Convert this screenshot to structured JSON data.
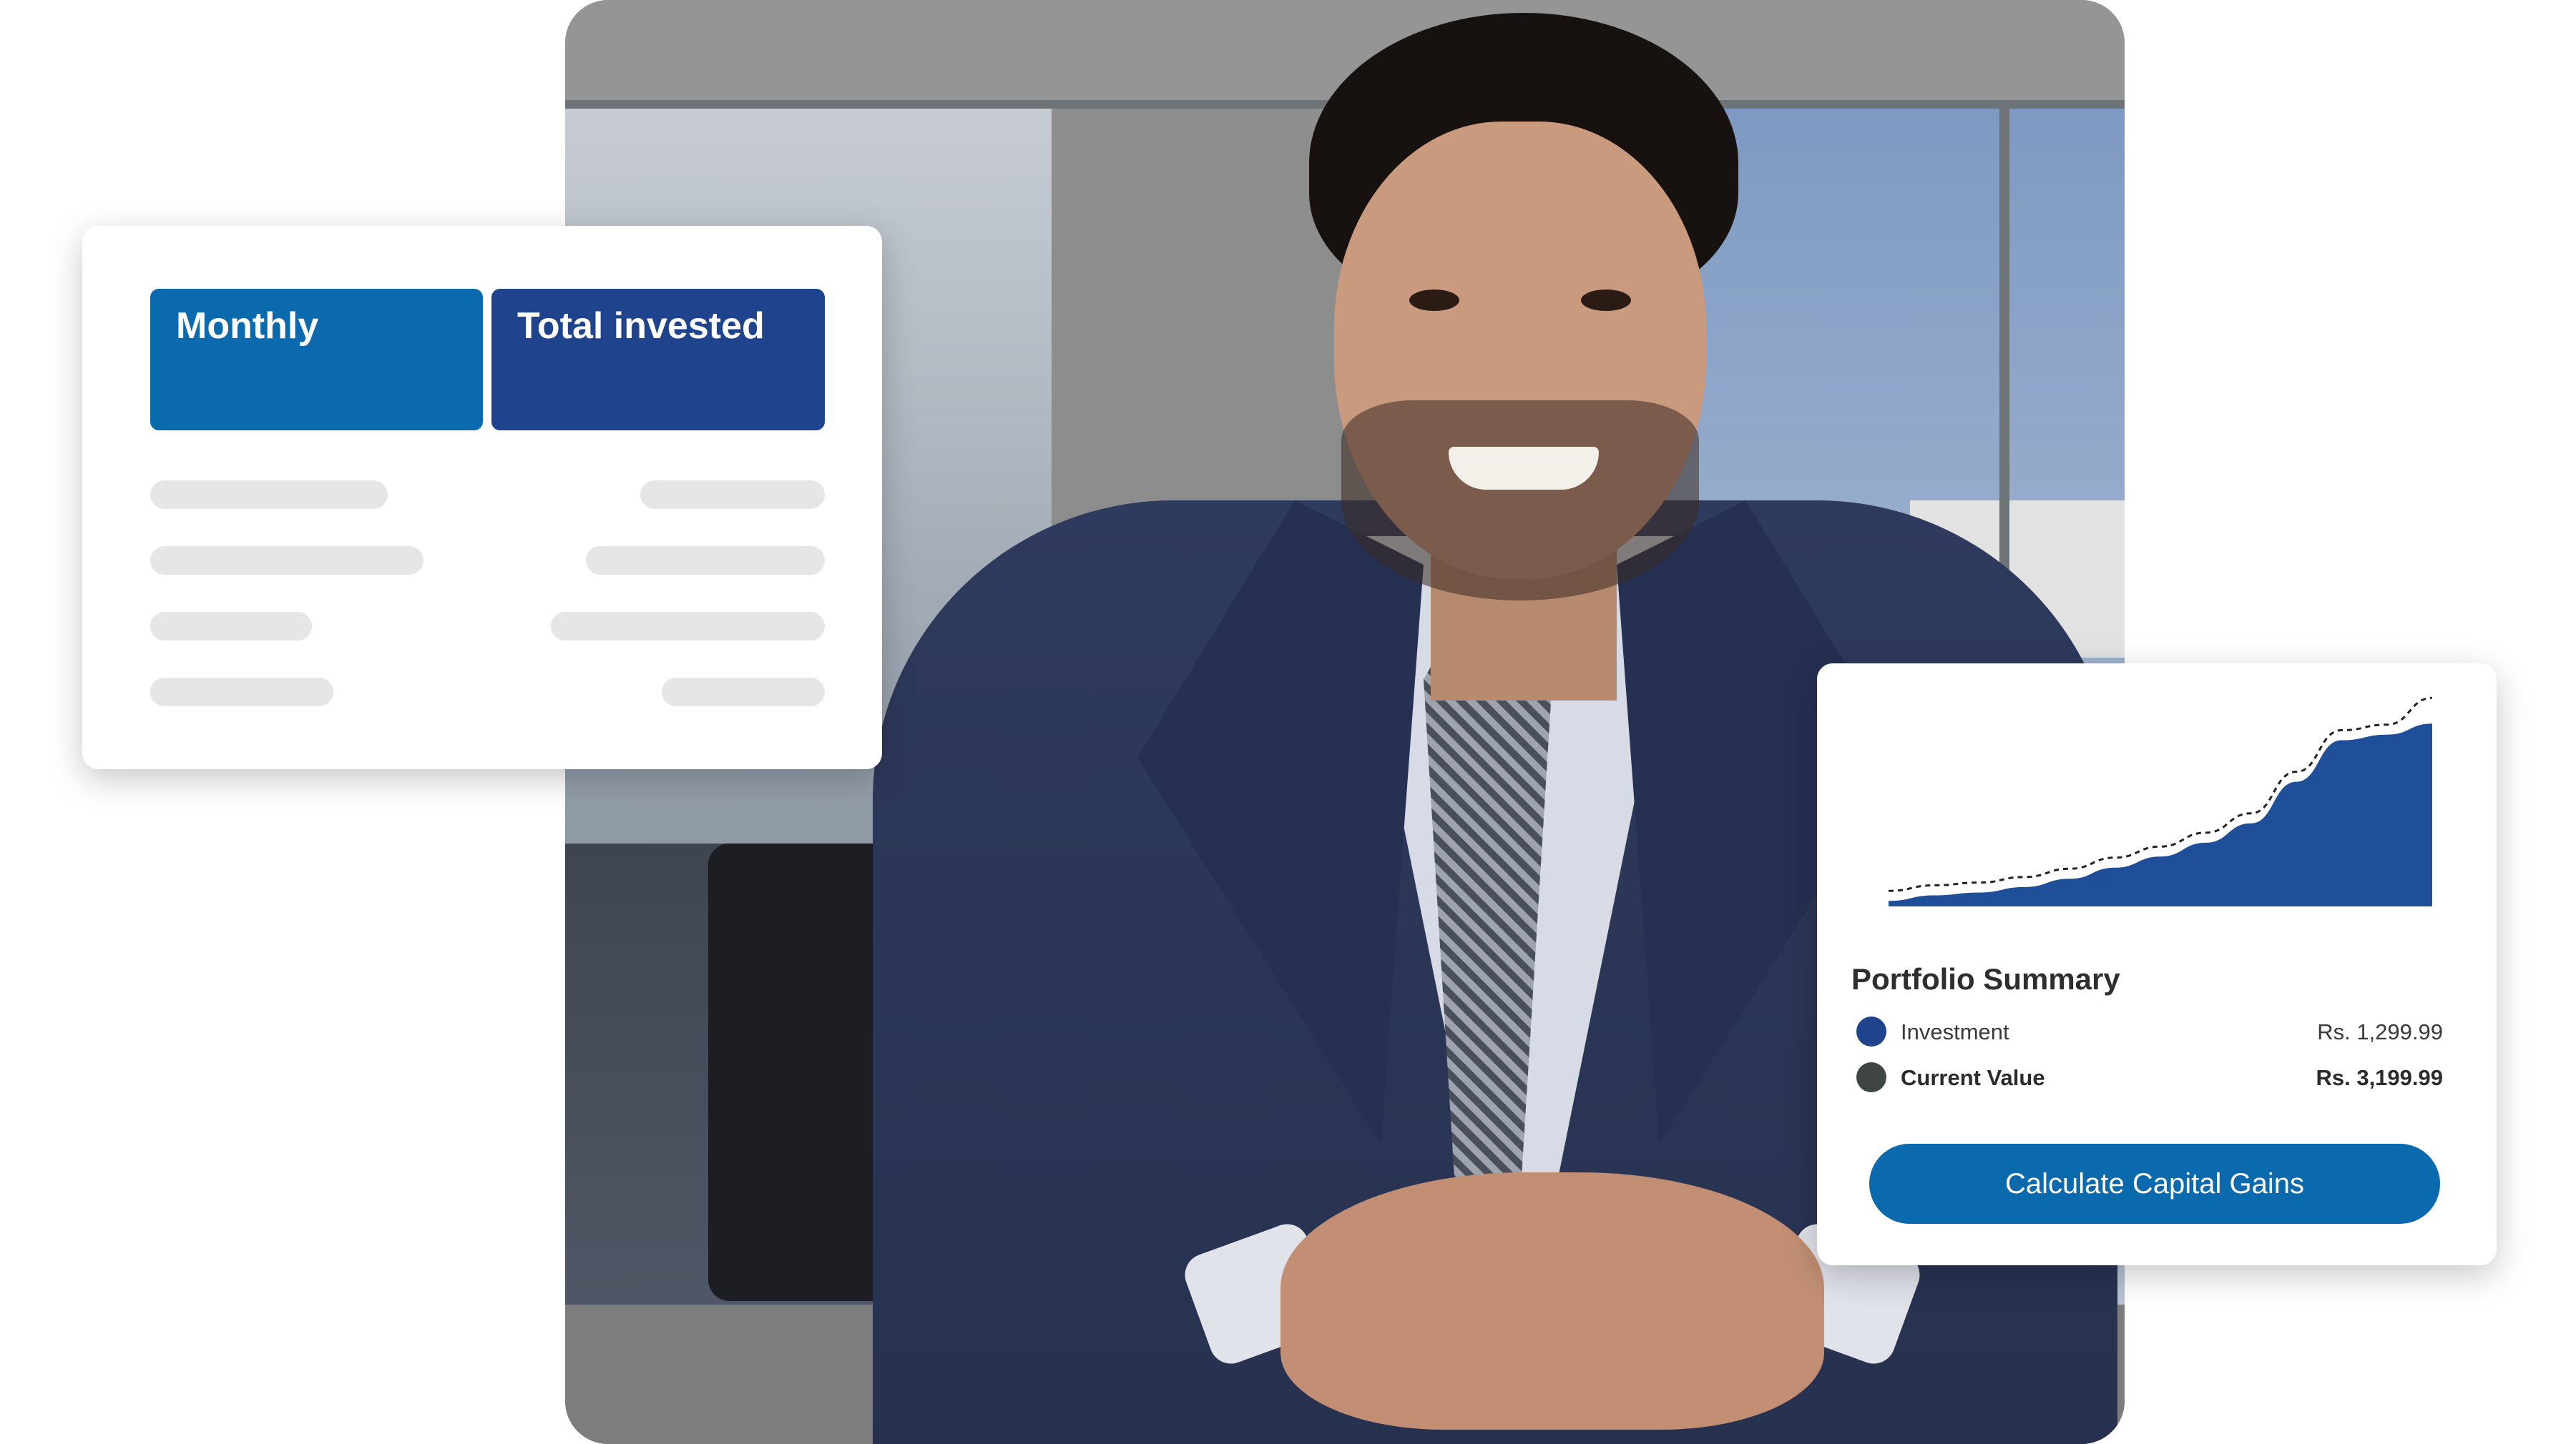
{
  "left_card": {
    "tabs": [
      {
        "label": "Monthly",
        "color": "#0b6aad"
      },
      {
        "label": "Total invested",
        "color": "#1f438d"
      }
    ]
  },
  "portfolio_card": {
    "title": "Portfolio Summary",
    "rows": [
      {
        "label": "Investment",
        "value": "Rs. 1,299.99",
        "dot_color": "#1f438d"
      },
      {
        "label": "Current Value",
        "value": "Rs. 3,199.99",
        "dot_color": "#3f4444"
      }
    ],
    "button_label": "Calculate Capital Gains",
    "accent_color": "#0b6aad"
  },
  "chart_data": {
    "type": "area",
    "x": [
      0,
      1,
      2,
      3,
      4,
      5,
      6,
      7,
      8,
      9,
      10,
      11,
      12
    ],
    "values": [
      2,
      4,
      5,
      7,
      10,
      14,
      18,
      23,
      30,
      45,
      60,
      62,
      66
    ],
    "ylim": [
      0,
      80
    ],
    "grid": false,
    "fill_color": "#1f4f99"
  }
}
